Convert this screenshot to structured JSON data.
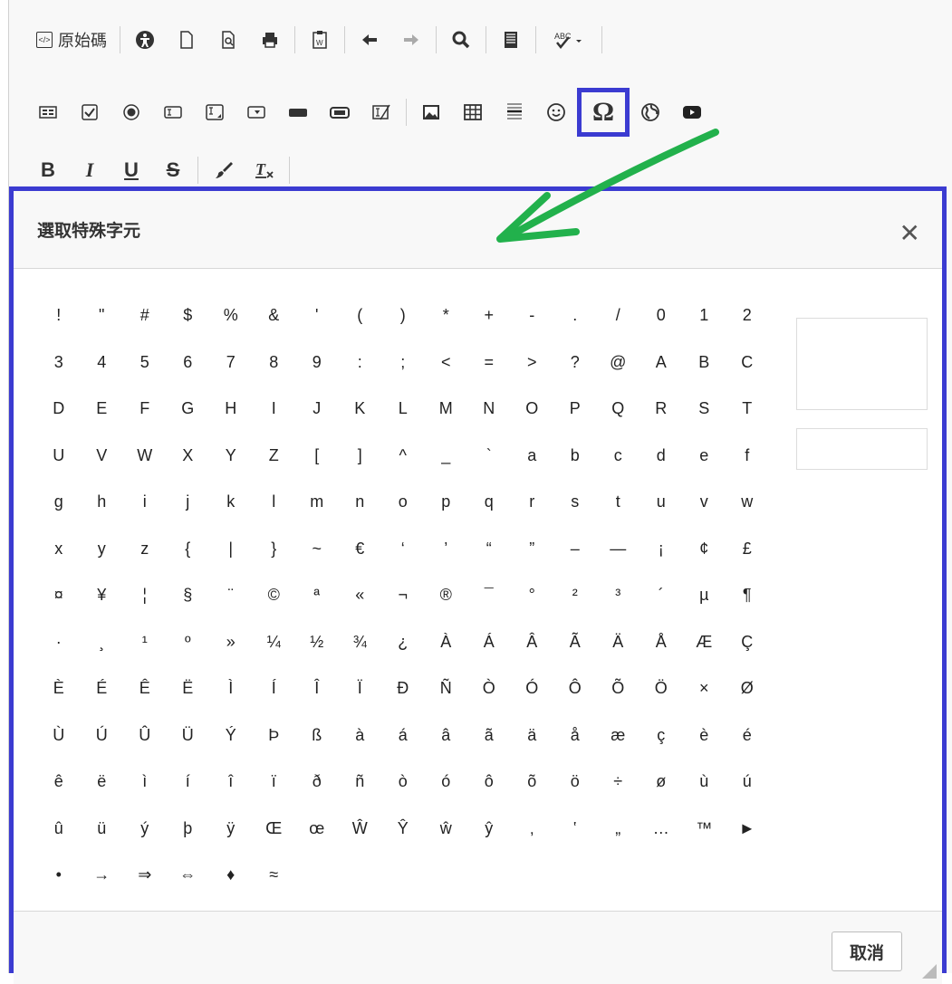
{
  "toolbar": {
    "source_label": "原始碼",
    "row1_icons": [
      "accessibility-icon",
      "new-page-icon",
      "preview-icon",
      "print-icon",
      "paste-word-icon",
      "undo-icon",
      "redo-icon",
      "find-icon",
      "format-icon",
      "spellcheck-icon"
    ],
    "row3": {
      "bold": "B",
      "italic": "I",
      "underline": "U",
      "strike": "S",
      "clear": "Tx"
    }
  },
  "highlight_color": "#3b3bd1",
  "arrow_color": "#22b14c",
  "dialog": {
    "title": "選取特殊字元",
    "close": "✕",
    "cancel_label": "取消",
    "characters": [
      "!",
      "\"",
      "#",
      "$",
      "%",
      "&",
      "'",
      "(",
      ")",
      "*",
      "+",
      "-",
      ".",
      "/",
      "0",
      "1",
      "2",
      "3",
      "4",
      "5",
      "6",
      "7",
      "8",
      "9",
      ":",
      ";",
      "<",
      "=",
      ">",
      "?",
      "@",
      "A",
      "B",
      "C",
      "D",
      "E",
      "F",
      "G",
      "H",
      "I",
      "J",
      "K",
      "L",
      "M",
      "N",
      "O",
      "P",
      "Q",
      "R",
      "S",
      "T",
      "U",
      "V",
      "W",
      "X",
      "Y",
      "Z",
      "[",
      "]",
      "^",
      "_",
      "`",
      "a",
      "b",
      "c",
      "d",
      "e",
      "f",
      "g",
      "h",
      "i",
      "j",
      "k",
      "l",
      "m",
      "n",
      "o",
      "p",
      "q",
      "r",
      "s",
      "t",
      "u",
      "v",
      "w",
      "x",
      "y",
      "z",
      "{",
      "|",
      "}",
      "~",
      "€",
      "‘",
      "’",
      "“",
      "”",
      "–",
      "—",
      "¡",
      "¢",
      "£",
      "¤",
      "¥",
      "¦",
      "§",
      "¨",
      "©",
      "ª",
      "«",
      "¬",
      "®",
      "¯",
      "°",
      "²",
      "³",
      "´",
      "µ",
      "¶",
      "·",
      "¸",
      "¹",
      "º",
      "»",
      "¼",
      "½",
      "¾",
      "¿",
      "À",
      "Á",
      "Â",
      "Ã",
      "Ä",
      "Å",
      "Æ",
      "Ç",
      "È",
      "É",
      "Ê",
      "Ë",
      "Ì",
      "Í",
      "Î",
      "Ï",
      "Ð",
      "Ñ",
      "Ò",
      "Ó",
      "Ô",
      "Õ",
      "Ö",
      "×",
      "Ø",
      "Ù",
      "Ú",
      "Û",
      "Ü",
      "Ý",
      "Þ",
      "ß",
      "à",
      "á",
      "â",
      "ã",
      "ä",
      "å",
      "æ",
      "ç",
      "è",
      "é",
      "ê",
      "ë",
      "ì",
      "í",
      "î",
      "ï",
      "ð",
      "ñ",
      "ò",
      "ó",
      "ô",
      "õ",
      "ö",
      "÷",
      "ø",
      "ù",
      "ú",
      "û",
      "ü",
      "ý",
      "þ",
      "ÿ",
      "Œ",
      "œ",
      "Ŵ",
      "Ŷ",
      "ŵ",
      "ŷ",
      "‚",
      "‛",
      "„",
      "…",
      "™",
      "►",
      "•",
      "→",
      "⇒",
      "⇔",
      "♦",
      "≈"
    ]
  }
}
